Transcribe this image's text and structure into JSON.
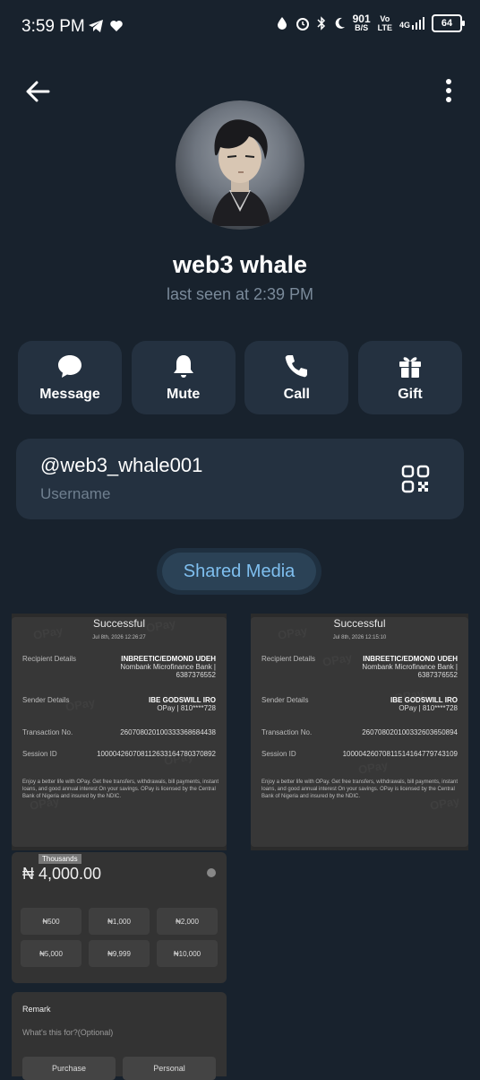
{
  "status_bar": {
    "time": "3:59 PM",
    "net_speed_value": "901",
    "net_speed_unit": "B/S",
    "volte_top": "Vo",
    "volte_bottom": "LTE",
    "network": "4G",
    "battery": "64",
    "icons": [
      "telegram-icon",
      "heart-icon",
      "data-saver-icon",
      "alarm-icon",
      "bluetooth-icon",
      "moon-icon",
      "signal-icon",
      "battery-icon"
    ]
  },
  "header": {
    "back_icon": "arrow-left-icon",
    "more_icon": "more-vertical-icon"
  },
  "profile": {
    "name": "web3 whale",
    "last_seen": "last seen at 2:39 PM"
  },
  "actions": [
    {
      "label": "Message",
      "icon": "chat-bubble-icon"
    },
    {
      "label": "Mute",
      "icon": "bell-icon"
    },
    {
      "label": "Call",
      "icon": "phone-icon"
    },
    {
      "label": "Gift",
      "icon": "gift-icon"
    }
  ],
  "username": {
    "value": "@web3_whale001",
    "label": "Username",
    "icon": "qr-code-icon"
  },
  "shared_media": {
    "label": "Shared Media"
  },
  "media": {
    "receipts": [
      {
        "title": "Successful",
        "date": "Jul 8th, 2026 12:26:27",
        "recipient_label": "Recipient Details",
        "recipient_name": "INBREETIC/EDMOND UDEH",
        "recipient_bank": "Nombank Microfinance Bank |",
        "recipient_account": "6387376552",
        "sender_label": "Sender Details",
        "sender_name": "IBE GODSWILL IRO",
        "sender_bank": "OPay | 810****728",
        "txn_label": "Transaction No.",
        "txn_value": "260708020100333368684438",
        "session_label": "Session ID",
        "session_value": "100004260708112633164780370892",
        "footer": "Enjoy a better life with OPay. Get free transfers, withdrawals, bill payments, instant loans, and good annual interest On your savings. OPay is licensed by the Central Bank of Nigeria and insured by the NDIC."
      },
      {
        "title": "Successful",
        "date": "Jul 8th, 2026 12:15:10",
        "recipient_label": "Recipient Details",
        "recipient_name": "INBREETIC/EDMOND UDEH",
        "recipient_bank": "Nombank Microfinance Bank |",
        "recipient_account": "6387376552",
        "sender_label": "Sender Details",
        "sender_name": "IBE GODSWILL IRO",
        "sender_bank": "OPay | 810****728",
        "txn_label": "Transaction No.",
        "txn_value": "260708020100332603650894",
        "session_label": "Session ID",
        "session_value": "100004260708115141647797431​09",
        "footer": "Enjoy a better life with OPay. Get free transfers, withdrawals, bill payments, instant loans, and good annual interest On your savings. OPay is licensed by the Central Bank of Nigeria and insured by the NDIC."
      }
    ],
    "watermark": "OPay",
    "amount_panel": {
      "tag": "Thousands",
      "amount": "₦ 4,000.00",
      "chips": [
        "₦500",
        "₦1,000",
        "₦2,000",
        "₦5,000",
        "₦9,999",
        "₦10,000"
      ]
    },
    "remark_panel": {
      "title": "Remark",
      "placeholder": "What's this for?(Optional)",
      "buttons": [
        "Purchase",
        "Personal"
      ]
    }
  },
  "colors": {
    "background": "#18222d",
    "card": "#243140",
    "accent": "#7fbfef",
    "muted_text": "#7a8a9a"
  }
}
